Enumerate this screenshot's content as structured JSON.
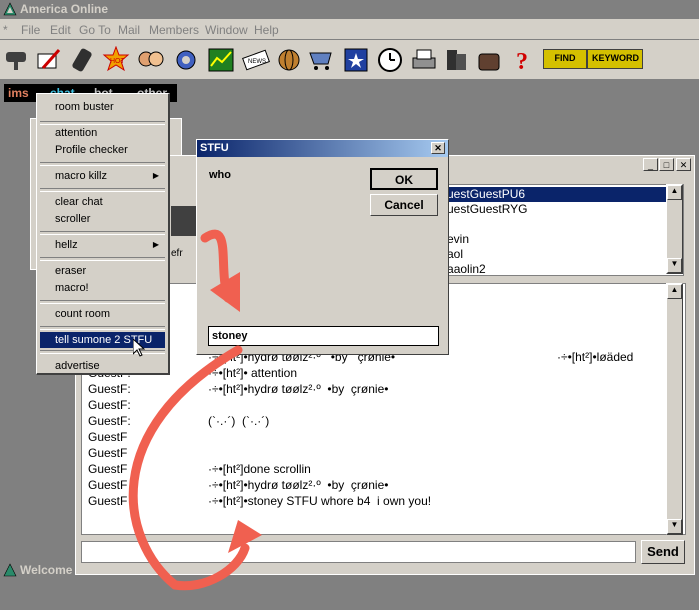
{
  "app": {
    "title": "America  Online"
  },
  "menubar": {
    "items": [
      "File",
      "Edit",
      "Go To",
      "Mail",
      "Members",
      "Window",
      "Help"
    ]
  },
  "toolbar": {
    "icons": [
      "handshake-icon",
      "pen-icon",
      "phone-icon",
      "hot-icon",
      "people-icon",
      "gear-icon",
      "chart-icon",
      "news-icon",
      "globe-icon",
      "cart-icon",
      "calendar-icon",
      "clock-icon",
      "printer-icon",
      "files-icon",
      "paw-icon",
      "help-icon"
    ],
    "find_label": "FIND",
    "keyword_label": "KEYWORD"
  },
  "ims_bar": {
    "ims": "ims",
    "chat": "chat",
    "bot": "bot",
    "other": "other"
  },
  "context_menu": {
    "items": [
      {
        "label": "room buster",
        "submenu": false
      },
      {
        "label": "attention",
        "submenu": false
      },
      {
        "label": "Profile checker",
        "submenu": false
      },
      {
        "label": "macro killz",
        "submenu": true
      },
      {
        "label": "clear chat",
        "submenu": false
      },
      {
        "label": "scroller",
        "submenu": false
      },
      {
        "label": "hellz",
        "submenu": true
      },
      {
        "label": "eraser",
        "submenu": false
      },
      {
        "label": "macro!",
        "submenu": false
      },
      {
        "label": "count room",
        "submenu": false
      },
      {
        "label": "tell sumone 2 STFU",
        "submenu": false
      },
      {
        "label": "advertise",
        "submenu": false
      }
    ],
    "selected": "tell sumone 2 STFU"
  },
  "dialog": {
    "title": "STFU",
    "prompt": "who",
    "ok_label": "OK",
    "cancel_label": "Cancel",
    "input_value": "stoney"
  },
  "chat": {
    "people": [
      "GuestPU6",
      "GuestRYG",
      "",
      "evin",
      "aol",
      "aolin2"
    ],
    "people_prefix": [
      "uest",
      "uest",
      "",
      "",
      "",
      "a"
    ],
    "log": [
      {
        "name": "",
        "msg": "·÷•[ht²]•hydrø tøølz²·º   •by   çrønie•",
        "right": "·÷•[ht²]•løäded"
      },
      {
        "name": "GuestF:",
        "msg": "·÷•[ht²]• attention"
      },
      {
        "name": "GuestF:",
        "msg": "·÷•[ht²]•hydrø tøølz²·º  •by  çrønie•"
      },
      {
        "name": "GuestF:",
        "msg": ""
      },
      {
        "name": "GuestF:",
        "msg": "(`·.·´)  (`·.·´)"
      },
      {
        "name": "GuestF",
        "msg": ""
      },
      {
        "name": "GuestF",
        "msg": ""
      },
      {
        "name": "GuestF",
        "msg": "·÷•[ht²]done scrollin"
      },
      {
        "name": "GuestF",
        "msg": "·÷•[ht²]•hydrø tøølz²·º  •by  çrønie•"
      },
      {
        "name": "GuestF",
        "msg": "·÷•[ht²]•stoney STFU whore b4  i own you!"
      }
    ],
    "send_label": "Send",
    "input_value": "",
    "refresh_fragment": "efr"
  },
  "taskbar": {
    "welcome": "Welcome"
  },
  "colors": {
    "accent": "#0a246a",
    "annotation_arrow": "#f06050",
    "title_bg": "#808080"
  }
}
